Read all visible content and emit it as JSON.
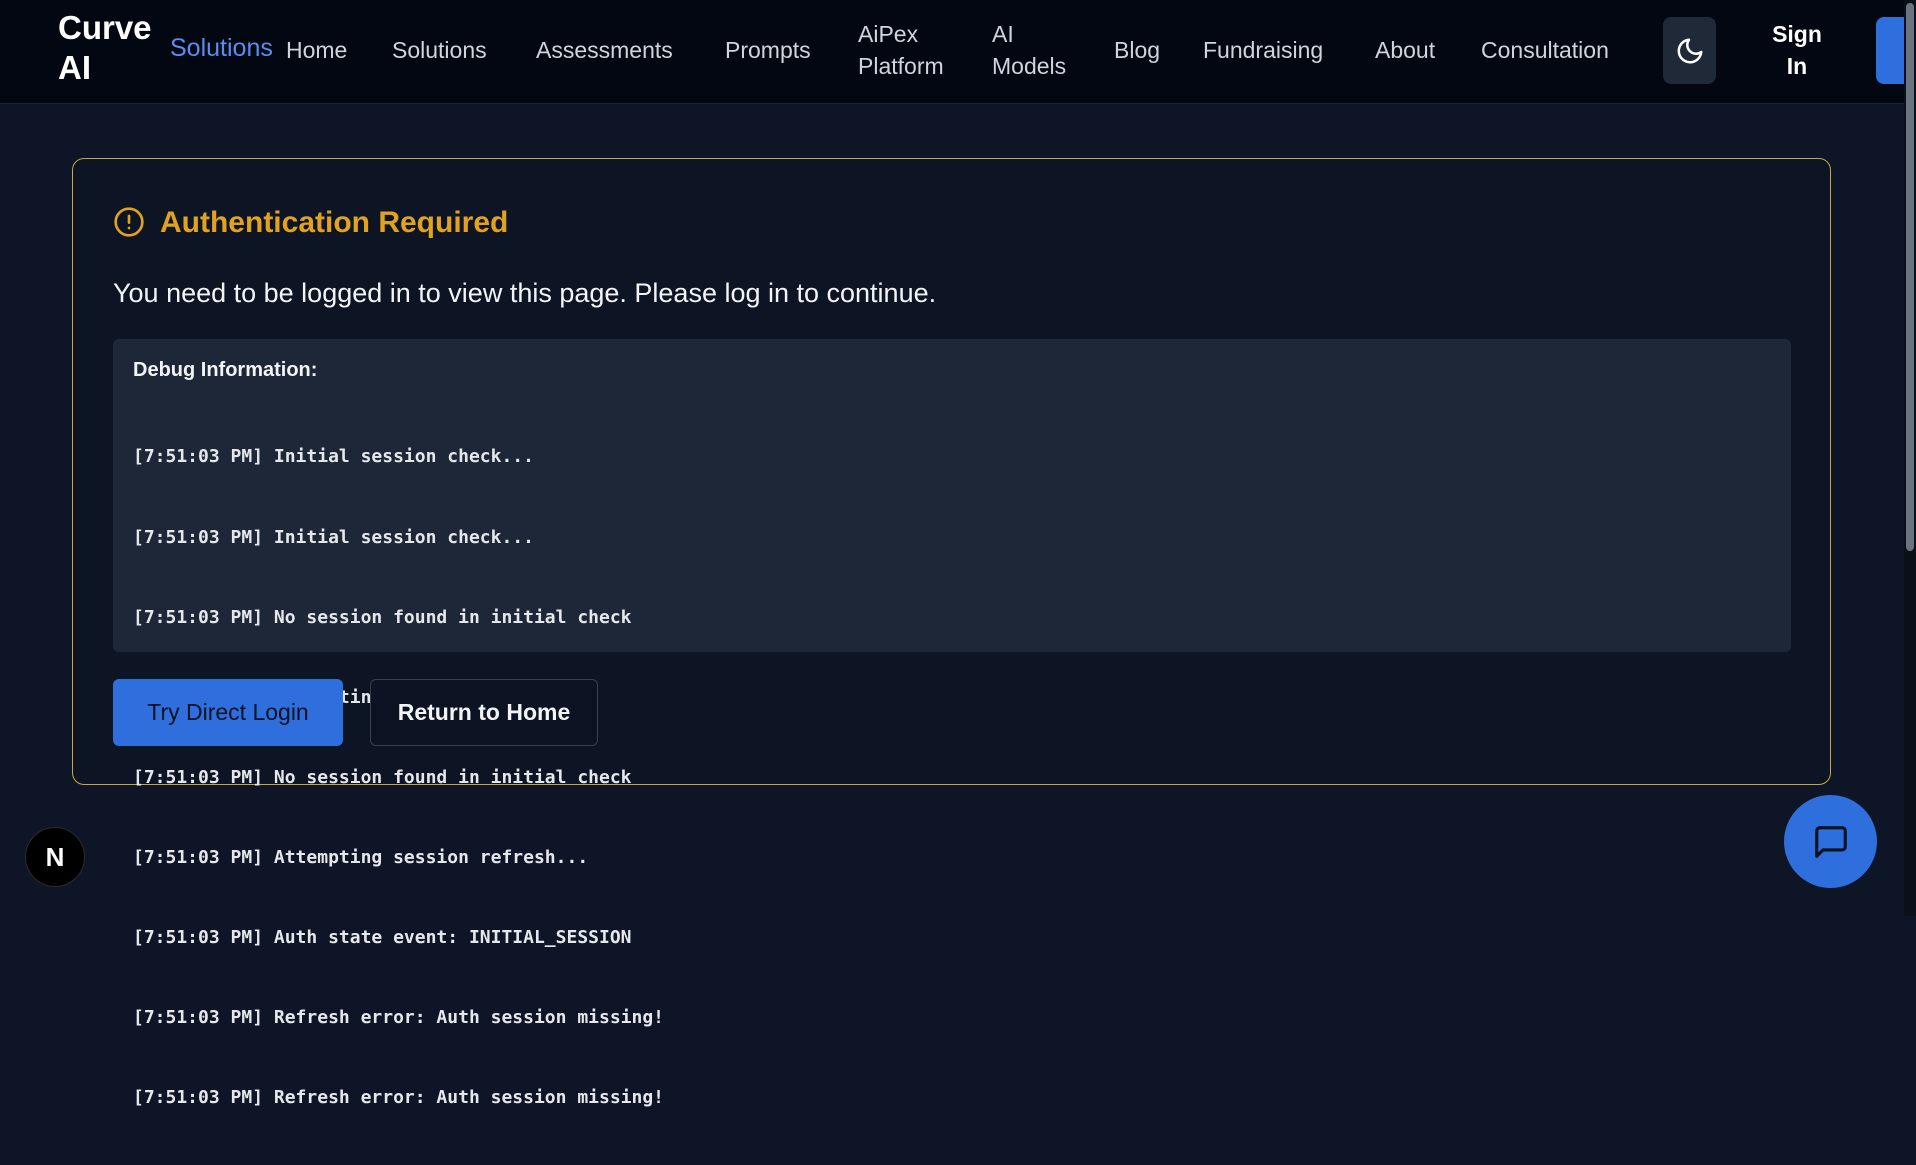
{
  "header": {
    "brand": "Curve AI",
    "brand_sub": "Solutions",
    "nav": [
      "Home",
      "Solutions",
      "Assessments",
      "Prompts",
      "AiPex Platform",
      "AI Models",
      "Blog",
      "Fundraising",
      "About",
      "Consultation"
    ],
    "theme_icon": "moon-icon",
    "sign_in": "Sign In"
  },
  "alert": {
    "icon": "alert-circle-icon",
    "title": "Authentication Required",
    "message": "You need to be logged in to view this page. Please log in to continue."
  },
  "debug": {
    "title": "Debug Information:",
    "logs": [
      "[7:51:03 PM] Initial session check...",
      "[7:51:03 PM] Initial session check...",
      "[7:51:03 PM] No session found in initial check",
      "[7:51:03 PM] Attempting session refresh...",
      "[7:51:03 PM] No session found in initial check",
      "[7:51:03 PM] Attempting session refresh...",
      "[7:51:03 PM] Auth state event: INITIAL_SESSION",
      "[7:51:03 PM] Refresh error: Auth session missing!",
      "[7:51:03 PM] Refresh error: Auth session missing!"
    ]
  },
  "actions": {
    "primary": "Try Direct Login",
    "secondary": "Return to Home"
  },
  "floating": {
    "next_badge": "N",
    "chat_icon": "chat-icon"
  },
  "colors": {
    "background": "#0e1526",
    "accent": "#2f6fdd",
    "warning": "#e0a21f",
    "card_border": "#c9a646"
  }
}
